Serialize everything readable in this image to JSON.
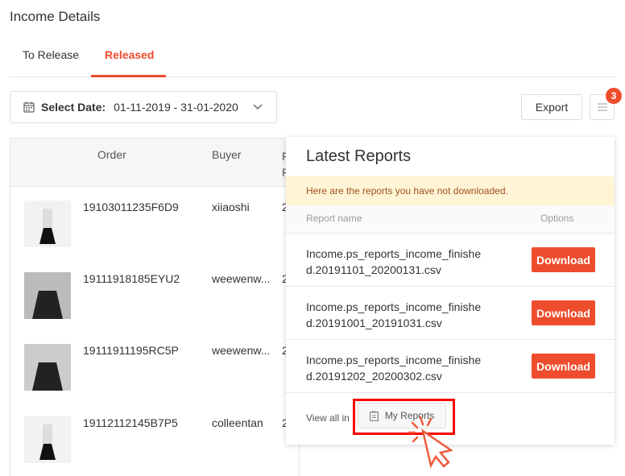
{
  "page": {
    "title": "Income Details"
  },
  "tabs": [
    {
      "label": "To Release"
    },
    {
      "label": "Released",
      "active": true
    }
  ],
  "date": {
    "label": "Select Date:",
    "value": "01-11-2019 - 31-01-2020"
  },
  "toolbar": {
    "export": "Export",
    "badge": "3"
  },
  "table": {
    "headers": [
      "Order",
      "Buyer",
      "F F"
    ],
    "rows": [
      {
        "order": "19103011235F6D9",
        "buyer": "xiiaoshi",
        "col3": "2"
      },
      {
        "order": "19111918185EYU2",
        "buyer": "weewenw...",
        "col3": "2"
      },
      {
        "order": "19111911195RC5P",
        "buyer": "weewenw...",
        "col3": "2"
      },
      {
        "order": "19112112145B7P5",
        "buyer": "colleentan",
        "col3": "2"
      }
    ]
  },
  "popup": {
    "title": "Latest Reports",
    "notice": "Here are the reports you have not downloaded.",
    "col_name": "Report name",
    "col_options": "Options",
    "reports": [
      {
        "line1": "Income.ps_reports_income_finishe",
        "line2": "d.20191101_20200131.csv",
        "action": "Download"
      },
      {
        "line1": "Income.ps_reports_income_finishe",
        "line2": "d.20191001_20191031.csv",
        "action": "Download"
      },
      {
        "line1": "Income.ps_reports_income_finishe",
        "line2": "d.20191202_20200302.csv",
        "action": "Download"
      }
    ],
    "view_all": "View all in",
    "my_reports": "My Reports"
  },
  "colors": {
    "accent": "#ee4d2d",
    "notice_bg": "#fff4d6",
    "highlight": "#ff0000"
  }
}
